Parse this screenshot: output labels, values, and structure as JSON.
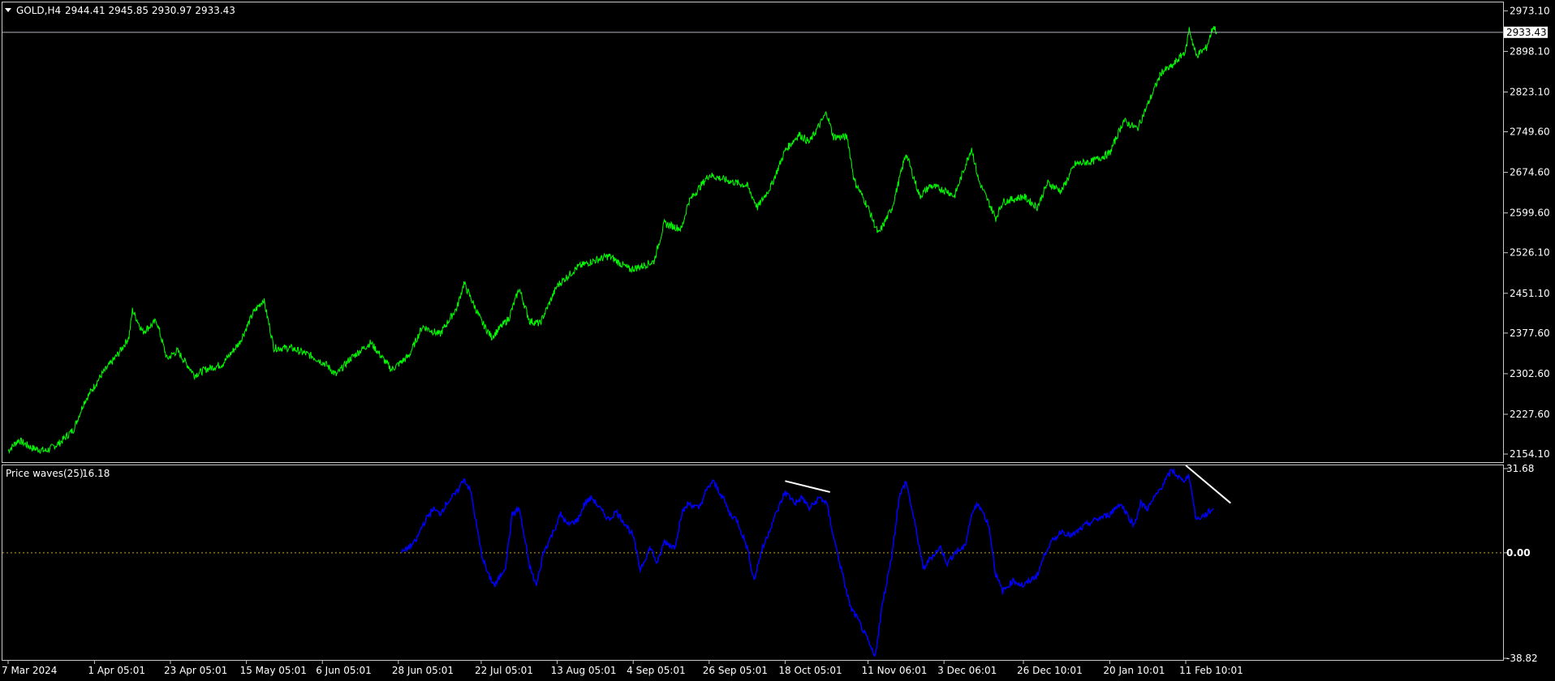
{
  "colors": {
    "background": "#000000",
    "price_line": "#00ff00",
    "indicator_line": "#0000ff",
    "zero_line": "#d4a017",
    "divergence_line": "#ffffff",
    "text": "#ffffff",
    "grid_frame": "#c8c8c8"
  },
  "header": {
    "menu_icon": "triangle-down-icon",
    "symbol": "GOLD,H4",
    "ohlc": "2944.41 2945.85 2930.97 2933.43"
  },
  "chart_data": [
    {
      "type": "line",
      "title": "GOLD,H4",
      "series": [
        {
          "name": "GOLD,H4",
          "x": [
            0,
            2,
            4,
            6,
            8,
            10,
            12,
            14,
            16,
            18,
            20,
            22,
            24,
            26,
            28,
            30,
            32,
            34,
            36,
            38,
            40,
            42,
            44,
            46,
            48,
            50,
            52,
            54,
            56,
            58,
            60,
            62,
            64,
            66,
            68,
            70,
            72,
            74,
            76,
            78,
            80,
            82,
            84,
            86,
            88,
            90,
            92,
            94,
            96,
            98,
            100,
            102,
            104,
            106,
            108,
            110,
            112,
            114,
            116,
            118,
            120,
            122,
            124,
            126,
            128,
            130,
            132,
            134,
            136,
            138,
            140,
            142,
            144,
            146,
            148,
            150
          ],
          "y": [
            2168,
            2172,
            2160,
            2176,
            2185,
            2280,
            2340,
            2372,
            2410,
            2395,
            2350,
            2380,
            2360,
            2320,
            2335,
            2370,
            2390,
            2425,
            2395,
            2360,
            2345,
            2355,
            2335,
            2320,
            2345,
            2330,
            2330,
            2310,
            2332,
            2350,
            2356,
            2400,
            2420,
            2460,
            2400,
            2410,
            2390,
            2450,
            2450,
            2430,
            2470,
            2480,
            2510,
            2515,
            2520,
            2500,
            2515,
            2520,
            2580,
            2600,
            2660,
            2675,
            2665,
            2640,
            2660,
            2690,
            2720,
            2750,
            2760,
            2780,
            2740,
            2680,
            2600,
            2660,
            2700,
            2650,
            2640,
            2660,
            2680,
            2700,
            2650,
            2620,
            2600,
            2640,
            2690,
            2720
          ],
          "note": "approximate shape, see price_points"
        }
      ],
      "price_points": [
        [
          "2024-03-07",
          2160
        ],
        [
          "2024-03-10",
          2180
        ],
        [
          "2024-03-14",
          2165
        ],
        [
          "2024-03-18",
          2160
        ],
        [
          "2024-03-22",
          2175
        ],
        [
          "2024-03-26",
          2200
        ],
        [
          "2024-03-29",
          2250
        ],
        [
          "2024-04-03",
          2300
        ],
        [
          "2024-04-08",
          2340
        ],
        [
          "2024-04-11",
          2370
        ],
        [
          "2024-04-12",
          2420
        ],
        [
          "2024-04-15",
          2380
        ],
        [
          "2024-04-19",
          2400
        ],
        [
          "2024-04-22",
          2330
        ],
        [
          "2024-04-25",
          2345
        ],
        [
          "2024-04-30",
          2300
        ],
        [
          "2024-05-03",
          2310
        ],
        [
          "2024-05-08",
          2320
        ],
        [
          "2024-05-13",
          2360
        ],
        [
          "2024-05-17",
          2415
        ],
        [
          "2024-05-20",
          2440
        ],
        [
          "2024-05-23",
          2350
        ],
        [
          "2024-05-28",
          2350
        ],
        [
          "2024-06-03",
          2335
        ],
        [
          "2024-06-07",
          2320
        ],
        [
          "2024-06-10",
          2300
        ],
        [
          "2024-06-14",
          2330
        ],
        [
          "2024-06-20",
          2360
        ],
        [
          "2024-06-26",
          2310
        ],
        [
          "2024-07-01",
          2335
        ],
        [
          "2024-07-05",
          2390
        ],
        [
          "2024-07-10",
          2375
        ],
        [
          "2024-07-15",
          2425
        ],
        [
          "2024-07-17",
          2470
        ],
        [
          "2024-07-22",
          2400
        ],
        [
          "2024-07-25",
          2370
        ],
        [
          "2024-07-30",
          2405
        ],
        [
          "2024-08-02",
          2460
        ],
        [
          "2024-08-05",
          2400
        ],
        [
          "2024-08-08",
          2395
        ],
        [
          "2024-08-13",
          2465
        ],
        [
          "2024-08-19",
          2500
        ],
        [
          "2024-08-23",
          2510
        ],
        [
          "2024-08-28",
          2520
        ],
        [
          "2024-09-03",
          2495
        ],
        [
          "2024-09-06",
          2500
        ],
        [
          "2024-09-10",
          2510
        ],
        [
          "2024-09-13",
          2580
        ],
        [
          "2024-09-18",
          2570
        ],
        [
          "2024-09-20",
          2620
        ],
        [
          "2024-09-26",
          2670
        ],
        [
          "2024-10-01",
          2660
        ],
        [
          "2024-10-07",
          2650
        ],
        [
          "2024-10-10",
          2610
        ],
        [
          "2024-10-14",
          2650
        ],
        [
          "2024-10-18",
          2715
        ],
        [
          "2024-10-22",
          2745
        ],
        [
          "2024-10-25",
          2730
        ],
        [
          "2024-10-30",
          2785
        ],
        [
          "2024-11-01",
          2740
        ],
        [
          "2024-11-05",
          2740
        ],
        [
          "2024-11-07",
          2660
        ],
        [
          "2024-11-11",
          2610
        ],
        [
          "2024-11-14",
          2560
        ],
        [
          "2024-11-18",
          2610
        ],
        [
          "2024-11-22",
          2710
        ],
        [
          "2024-11-26",
          2630
        ],
        [
          "2024-11-29",
          2650
        ],
        [
          "2024-12-04",
          2640
        ],
        [
          "2024-12-06",
          2630
        ],
        [
          "2024-12-11",
          2720
        ],
        [
          "2024-12-13",
          2660
        ],
        [
          "2024-12-18",
          2590
        ],
        [
          "2024-12-20",
          2620
        ],
        [
          "2024-12-26",
          2630
        ],
        [
          "2024-12-30",
          2610
        ],
        [
          "2025-01-02",
          2655
        ],
        [
          "2025-01-06",
          2640
        ],
        [
          "2025-01-10",
          2690
        ],
        [
          "2025-01-15",
          2695
        ],
        [
          "2025-01-20",
          2710
        ],
        [
          "2025-01-24",
          2770
        ],
        [
          "2025-01-28",
          2755
        ],
        [
          "2025-01-31",
          2800
        ],
        [
          "2025-02-04",
          2860
        ],
        [
          "2025-02-07",
          2870
        ],
        [
          "2025-02-11",
          2900
        ],
        [
          "2025-02-12",
          2940
        ],
        [
          "2025-02-14",
          2890
        ],
        [
          "2025-02-17",
          2905
        ],
        [
          "2025-02-19",
          2945
        ],
        [
          "2025-02-20",
          2933.43
        ]
      ],
      "y_ticks": [
        "2973.10",
        "2898.10",
        "2823.10",
        "2749.60",
        "2674.60",
        "2599.60",
        "2526.10",
        "2451.10",
        "2377.60",
        "2302.60",
        "2227.60",
        "2154.10"
      ],
      "y_tick_values": [
        2973.1,
        2898.1,
        2823.1,
        2749.6,
        2674.6,
        2599.6,
        2526.1,
        2451.1,
        2377.6,
        2302.6,
        2227.6,
        2154.1
      ],
      "ylim": [
        2139.2,
        2988.6
      ],
      "current_price": "2933.43",
      "current_price_value": 2933.43,
      "x_ticks": [
        "7 Mar 2024",
        "1 Apr 05:01",
        "23 Apr 05:01",
        "15 May 05:01",
        "6 Jun 05:01",
        "28 Jun 05:01",
        "22 Jul 05:01",
        "13 Aug 05:01",
        "4 Sep 05:01",
        "26 Sep 05:01",
        "18 Oct 05:01",
        "11 Nov 06:01",
        "3 Dec 06:01",
        "26 Dec 10:01",
        "20 Jan 10:01",
        "11 Feb 10:01"
      ],
      "x_tick_dates": [
        "2024-03-07",
        "2024-04-01",
        "2024-04-23",
        "2024-05-15",
        "2024-06-06",
        "2024-06-28",
        "2024-07-22",
        "2024-08-13",
        "2024-09-04",
        "2024-09-26",
        "2024-10-18",
        "2024-11-11",
        "2024-12-03",
        "2024-12-26",
        "2025-01-20",
        "2025-02-11"
      ]
    },
    {
      "type": "line",
      "title": "Price waves(25) 16.18",
      "indicator_name": "Price waves(25)",
      "indicator_value": "16.18",
      "ylim": [
        -38.82,
        31.68
      ],
      "y_ticks": [
        "31.68",
        "0.00",
        "-38.82"
      ],
      "y_tick_values": [
        31.68,
        0.0,
        -38.82
      ],
      "zero_level": 0,
      "series": [
        {
          "name": "Price waves(25)",
          "points": [
            [
              "2024-06-29",
              0
            ],
            [
              "2024-07-01",
              2
            ],
            [
              "2024-07-03",
              4
            ],
            [
              "2024-07-05",
              10
            ],
            [
              "2024-07-08",
              16
            ],
            [
              "2024-07-10",
              14
            ],
            [
              "2024-07-12",
              18
            ],
            [
              "2024-07-15",
              22
            ],
            [
              "2024-07-17",
              27
            ],
            [
              "2024-07-19",
              22
            ],
            [
              "2024-07-22",
              0
            ],
            [
              "2024-07-24",
              -8
            ],
            [
              "2024-07-26",
              -12
            ],
            [
              "2024-07-29",
              -5
            ],
            [
              "2024-07-31",
              14
            ],
            [
              "2024-08-02",
              16
            ],
            [
              "2024-08-05",
              -5
            ],
            [
              "2024-08-07",
              -12
            ],
            [
              "2024-08-09",
              0
            ],
            [
              "2024-08-12",
              8
            ],
            [
              "2024-08-14",
              14
            ],
            [
              "2024-08-16",
              10
            ],
            [
              "2024-08-19",
              12
            ],
            [
              "2024-08-21",
              18
            ],
            [
              "2024-08-23",
              20
            ],
            [
              "2024-08-26",
              15
            ],
            [
              "2024-08-28",
              12
            ],
            [
              "2024-08-30",
              15
            ],
            [
              "2024-09-02",
              10
            ],
            [
              "2024-09-04",
              6
            ],
            [
              "2024-09-06",
              -6
            ],
            [
              "2024-09-09",
              2
            ],
            [
              "2024-09-11",
              -4
            ],
            [
              "2024-09-13",
              4
            ],
            [
              "2024-09-16",
              2
            ],
            [
              "2024-09-18",
              14
            ],
            [
              "2024-09-20",
              18
            ],
            [
              "2024-09-23",
              16
            ],
            [
              "2024-09-25",
              22
            ],
            [
              "2024-09-27",
              26
            ],
            [
              "2024-09-30",
              20
            ],
            [
              "2024-10-02",
              14
            ],
            [
              "2024-10-04",
              12
            ],
            [
              "2024-10-07",
              2
            ],
            [
              "2024-10-09",
              -10
            ],
            [
              "2024-10-11",
              0
            ],
            [
              "2024-10-14",
              10
            ],
            [
              "2024-10-16",
              16
            ],
            [
              "2024-10-18",
              22
            ],
            [
              "2024-10-21",
              18
            ],
            [
              "2024-10-23",
              20
            ],
            [
              "2024-10-25",
              16
            ],
            [
              "2024-10-28",
              20
            ],
            [
              "2024-10-30",
              18
            ],
            [
              "2024-11-01",
              6
            ],
            [
              "2024-11-04",
              -10
            ],
            [
              "2024-11-06",
              -20
            ],
            [
              "2024-11-08",
              -24
            ],
            [
              "2024-11-11",
              -32
            ],
            [
              "2024-11-13",
              -38
            ],
            [
              "2024-11-15",
              -20
            ],
            [
              "2024-11-18",
              0
            ],
            [
              "2024-11-20",
              20
            ],
            [
              "2024-11-22",
              26
            ],
            [
              "2024-11-25",
              8
            ],
            [
              "2024-11-27",
              -6
            ],
            [
              "2024-11-29",
              -2
            ],
            [
              "2024-12-02",
              2
            ],
            [
              "2024-12-04",
              -4
            ],
            [
              "2024-12-06",
              0
            ],
            [
              "2024-12-09",
              2
            ],
            [
              "2024-12-11",
              14
            ],
            [
              "2024-12-13",
              18
            ],
            [
              "2024-12-16",
              10
            ],
            [
              "2024-12-18",
              -8
            ],
            [
              "2024-12-20",
              -14
            ],
            [
              "2024-12-23",
              -10
            ],
            [
              "2024-12-26",
              -12
            ],
            [
              "2024-12-30",
              -8
            ],
            [
              "2025-01-02",
              2
            ],
            [
              "2025-01-06",
              8
            ],
            [
              "2025-01-09",
              6
            ],
            [
              "2025-01-13",
              10
            ],
            [
              "2025-01-16",
              12
            ],
            [
              "2025-01-20",
              14
            ],
            [
              "2025-01-23",
              18
            ],
            [
              "2025-01-27",
              10
            ],
            [
              "2025-01-29",
              18
            ],
            [
              "2025-01-31",
              16
            ],
            [
              "2025-02-03",
              22
            ],
            [
              "2025-02-05",
              26
            ],
            [
              "2025-02-07",
              30
            ],
            [
              "2025-02-10",
              26
            ],
            [
              "2025-02-12",
              28
            ],
            [
              "2025-02-14",
              12
            ],
            [
              "2025-02-17",
              14
            ],
            [
              "2025-02-19",
              16.18
            ]
          ]
        }
      ],
      "annotations": [
        {
          "type": "trendline",
          "from": [
            "2024-10-18",
            26
          ],
          "to": [
            "2024-10-31",
            22
          ]
        },
        {
          "type": "trendline",
          "from": [
            "2025-02-11",
            31.68
          ],
          "to": [
            "2025-02-24",
            18
          ]
        }
      ]
    }
  ]
}
